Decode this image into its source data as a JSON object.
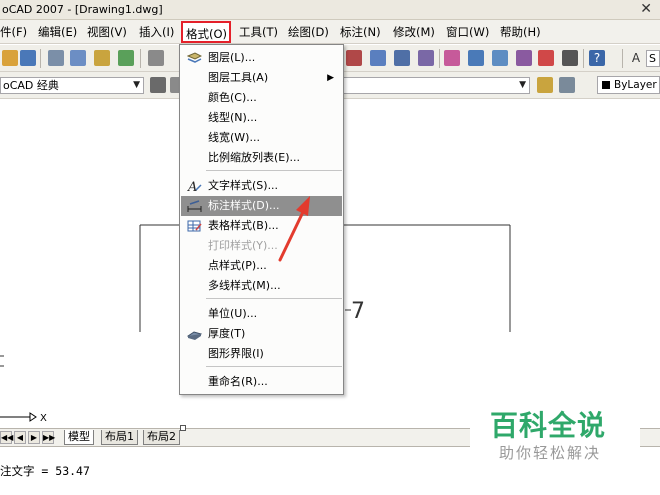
{
  "window": {
    "title": "oCAD 2007 - [Drawing1.dwg]",
    "close_glyph": "✕"
  },
  "menubar": {
    "items": [
      "件(F)",
      "编辑(E)",
      "视图(V)",
      "插入(I)",
      "格式(O)",
      "工具(T)",
      "绘图(D)",
      "标注(N)",
      "修改(M)",
      "窗口(W)",
      "帮助(H)"
    ],
    "active_index": 4,
    "highlight_color": "#e4202a"
  },
  "toolbar": {
    "workspace": "oCAD 经典",
    "bylayer": "ByLayer",
    "right_partial": "S"
  },
  "format_menu": {
    "items": [
      {
        "label": "图层(L)...",
        "icon": "layers-icon"
      },
      {
        "label": "图层工具(A)",
        "submenu": true
      },
      {
        "label": "颜色(C)..."
      },
      {
        "label": "线型(N)..."
      },
      {
        "label": "线宽(W)..."
      },
      {
        "label": "比例缩放列表(E)..."
      },
      {
        "label": "文字样式(S)...",
        "icon": "text-style-icon"
      },
      {
        "label": "标注样式(D)...",
        "icon": "dimension-style-icon",
        "highlighted": true
      },
      {
        "label": "表格样式(B)...",
        "icon": "table-style-icon"
      },
      {
        "label": "打印样式(Y)...",
        "disabled": true
      },
      {
        "label": "点样式(P)..."
      },
      {
        "label": "多线样式(M)..."
      },
      {
        "label": "单位(U)..."
      },
      {
        "label": "厚度(T)",
        "icon": "thickness-icon"
      },
      {
        "label": "图形界限(I)"
      },
      {
        "label": "重命名(R)..."
      }
    ],
    "submenu_arrow": "▶"
  },
  "drawing": {
    "dimension_text": "7",
    "axis_label": "X",
    "arrow_color": "#e33b2e"
  },
  "tabs": {
    "nav": [
      "◀◀",
      "◀",
      "▶",
      "▶▶"
    ],
    "items": [
      "模型",
      "布局1",
      "布局2"
    ],
    "active_index": 0
  },
  "command": {
    "text": "注文字 = 53.47"
  },
  "watermark": {
    "title": "百科全说",
    "subtitle": "助你轻松解决",
    "color": "#2fa86a"
  }
}
